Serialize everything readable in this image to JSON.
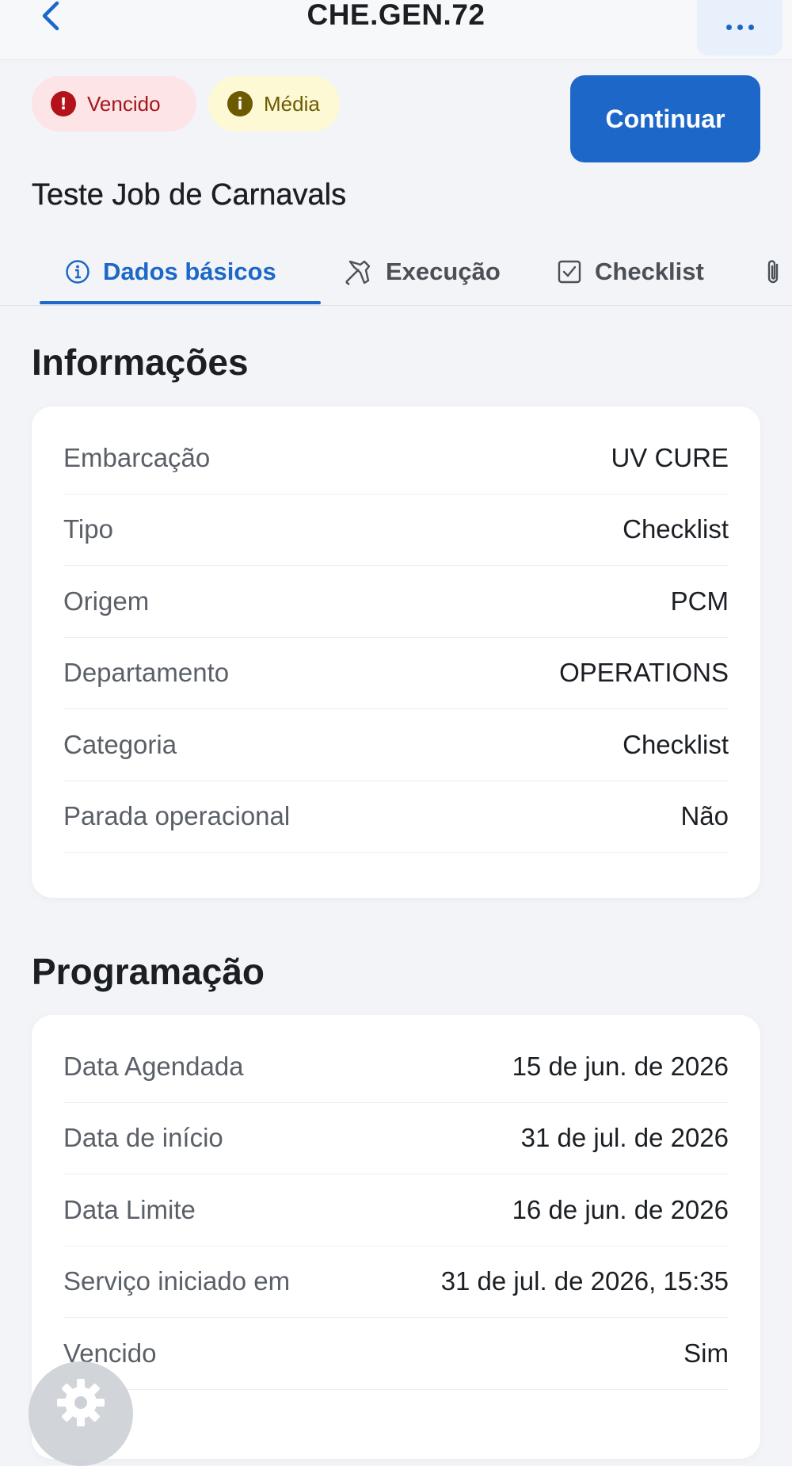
{
  "header": {
    "back_icon": "chevron-left-icon",
    "code": "CHE.GEN.72",
    "more_icon": "more-horizontal-icon"
  },
  "badges": {
    "overdue": {
      "label": "Vencido",
      "icon": "!",
      "color": "#b3121a"
    },
    "priority": {
      "label": "Média",
      "icon": "i",
      "color": "#6b5a00"
    }
  },
  "actions": {
    "continue_label": "Continuar"
  },
  "job": {
    "title": "Teste Job de Carnavals"
  },
  "tabs": [
    {
      "label": "Dados básicos",
      "icon": "info-circle-icon",
      "active": true
    },
    {
      "label": "Execução",
      "icon": "tools-icon",
      "active": false
    },
    {
      "label": "Checklist",
      "icon": "checkbox-icon",
      "active": false
    },
    {
      "label": "",
      "icon": "paperclip-icon",
      "active": false
    }
  ],
  "info": {
    "title": "Informações",
    "rows": [
      {
        "label": "Embarcação",
        "value": "UV CURE"
      },
      {
        "label": "Tipo",
        "value": "Checklist"
      },
      {
        "label": "Origem",
        "value": "PCM"
      },
      {
        "label": "Departamento",
        "value": "OPERATIONS"
      },
      {
        "label": "Categoria",
        "value": "Checklist"
      },
      {
        "label": "Parada operacional",
        "value": "Não"
      }
    ]
  },
  "schedule": {
    "title": "Programação",
    "rows": [
      {
        "label": "Data Agendada",
        "value": "15 de jun. de 2026"
      },
      {
        "label": "Data de início",
        "value": "31 de jul. de 2026"
      },
      {
        "label": "Data Limite",
        "value": "16 de jun. de 2026"
      },
      {
        "label": "Serviço iniciado em",
        "value": "31 de jul. de 2026, 15:35"
      },
      {
        "label": "Vencido",
        "value": "Sim"
      }
    ]
  },
  "fab": {
    "icon": "gear-icon"
  },
  "colors": {
    "accent": "#1c67c8",
    "background": "#f2f4f8",
    "danger": "#b3121a",
    "warning": "#6b5a00"
  }
}
